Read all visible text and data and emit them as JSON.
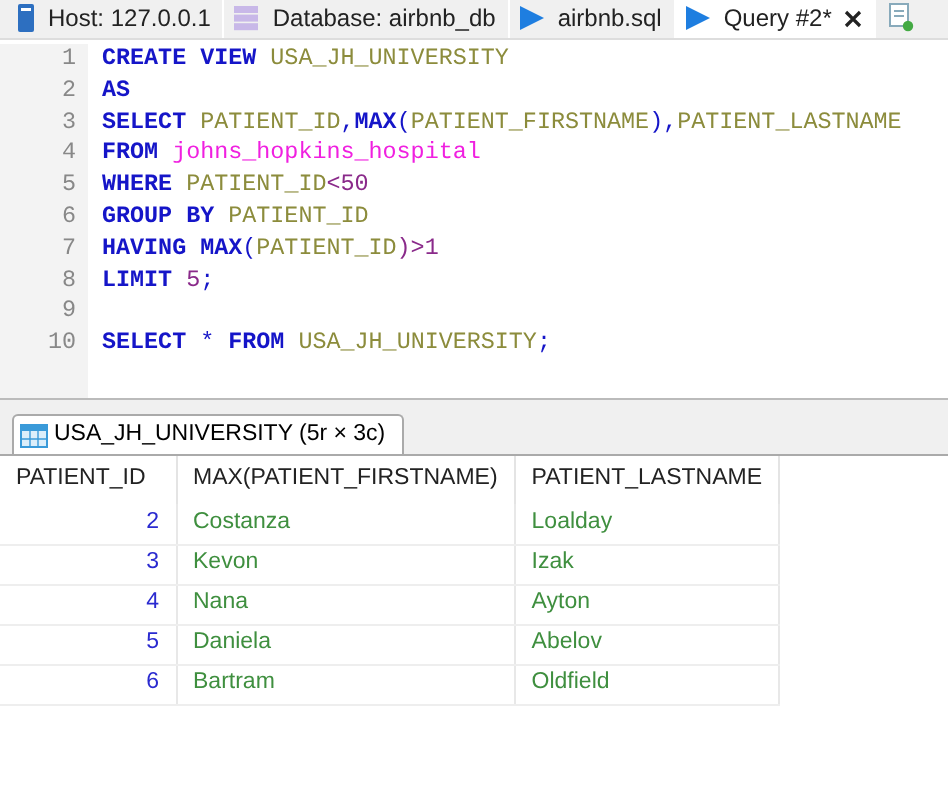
{
  "tabs": [
    {
      "kind": "host",
      "label": "Host: 127.0.0.1",
      "selected": false,
      "closable": false
    },
    {
      "kind": "database",
      "label": "Database: airbnb_db",
      "selected": false,
      "closable": false
    },
    {
      "kind": "file",
      "label": "airbnb.sql",
      "selected": false,
      "closable": false
    },
    {
      "kind": "query",
      "label": "Query #2*",
      "selected": true,
      "closable": true
    }
  ],
  "editor": {
    "lines": [
      {
        "number": "1",
        "tokens": [
          {
            "kind": "keyword",
            "text": "CREATE VIEW "
          },
          {
            "kind": "identifier",
            "text": "USA_JH_UNIVERSITY"
          }
        ]
      },
      {
        "number": "2",
        "tokens": [
          {
            "kind": "keyword",
            "text": "AS"
          }
        ]
      },
      {
        "number": "3",
        "tokens": [
          {
            "kind": "keyword",
            "text": "SELECT "
          },
          {
            "kind": "identifier",
            "text": "PATIENT_ID"
          },
          {
            "kind": "symbol",
            "text": ","
          },
          {
            "kind": "keyword",
            "text": "MAX"
          },
          {
            "kind": "symbol",
            "text": "("
          },
          {
            "kind": "identifier",
            "text": "PATIENT_FIRSTNAME"
          },
          {
            "kind": "symbol",
            "text": "),"
          },
          {
            "kind": "identifier",
            "text": "PATIENT_LASTNAME"
          }
        ]
      },
      {
        "number": "4",
        "tokens": [
          {
            "kind": "keyword",
            "text": "FROM "
          },
          {
            "kind": "table",
            "text": "johns_hopkins_hospital"
          }
        ]
      },
      {
        "number": "5",
        "tokens": [
          {
            "kind": "keyword",
            "text": "WHERE "
          },
          {
            "kind": "identifier",
            "text": "PATIENT_ID"
          },
          {
            "kind": "number",
            "text": "<50"
          }
        ]
      },
      {
        "number": "6",
        "tokens": [
          {
            "kind": "keyword",
            "text": "GROUP BY "
          },
          {
            "kind": "identifier",
            "text": "PATIENT_ID"
          }
        ]
      },
      {
        "number": "7",
        "tokens": [
          {
            "kind": "keyword",
            "text": "HAVING MAX"
          },
          {
            "kind": "symbol",
            "text": "("
          },
          {
            "kind": "identifier",
            "text": "PATIENT_ID"
          },
          {
            "kind": "number",
            "text": ")>1"
          }
        ]
      },
      {
        "number": "8",
        "tokens": [
          {
            "kind": "keyword",
            "text": "LIMIT "
          },
          {
            "kind": "number",
            "text": "5"
          },
          {
            "kind": "symbol",
            "text": ";"
          }
        ]
      },
      {
        "number": "9"
      },
      {
        "number": "10",
        "tokens": [
          {
            "kind": "keyword",
            "text": "SELECT "
          },
          {
            "kind": "symbol",
            "text": "* "
          },
          {
            "kind": "keyword",
            "text": "FROM "
          },
          {
            "kind": "identifier",
            "text": "USA_JH_UNIVERSITY"
          },
          {
            "kind": "symbol",
            "text": ";"
          }
        ]
      }
    ]
  },
  "result_tabs": [
    {
      "label": "USA_JH_UNIVERSITY (5r × 3c)",
      "selected": true
    }
  ],
  "table": {
    "columns": [
      "PATIENT_ID",
      "MAX(PATIENT_FIRSTNAME)",
      "PATIENT_LASTNAME"
    ],
    "rows": [
      [
        "2",
        "Costanza",
        "Loalday"
      ],
      [
        "3",
        "Kevon",
        "Izak"
      ],
      [
        "4",
        "Nana",
        "Ayton"
      ],
      [
        "5",
        "Daniela",
        "Abelov"
      ],
      [
        "6",
        "Bartram",
        "Oldfield"
      ]
    ]
  }
}
